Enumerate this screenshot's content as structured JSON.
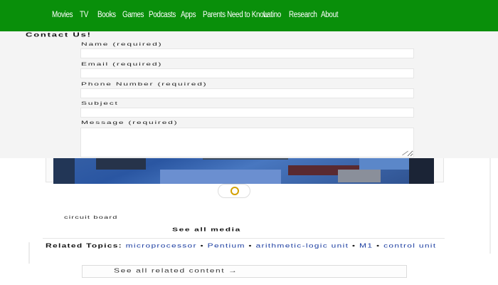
{
  "nav": {
    "items": [
      {
        "label": "Movies"
      },
      {
        "label": "TV"
      },
      {
        "label": "Books"
      },
      {
        "label": "Games"
      },
      {
        "label": "Podcasts"
      },
      {
        "label": "Apps"
      },
      {
        "label": "Parents Need to Know"
      },
      {
        "label": "Latino"
      },
      {
        "label": "Research"
      },
      {
        "label": "About"
      }
    ]
  },
  "contact": {
    "title": "Contact Us!",
    "fields": [
      {
        "label": "Name (required)",
        "value": ""
      },
      {
        "label": "Email (required)",
        "value": ""
      },
      {
        "label": "Phone Number (required)",
        "value": ""
      },
      {
        "label": "Subject",
        "value": ""
      },
      {
        "label": "Message (required)",
        "value": ""
      }
    ]
  },
  "media": {
    "caption": "circuit board",
    "see_all_label": "See all media"
  },
  "related": {
    "label": "Related Topics:",
    "topics": [
      "microprocessor",
      "Pentium",
      "arithmetic-logic unit",
      "M1",
      "control unit"
    ],
    "separator": "•",
    "see_all_label": "See all related content →"
  },
  "colors": {
    "nav_background": "#098f0a",
    "link": "#1a3ca0",
    "panel_background": "#f4f4f4"
  }
}
